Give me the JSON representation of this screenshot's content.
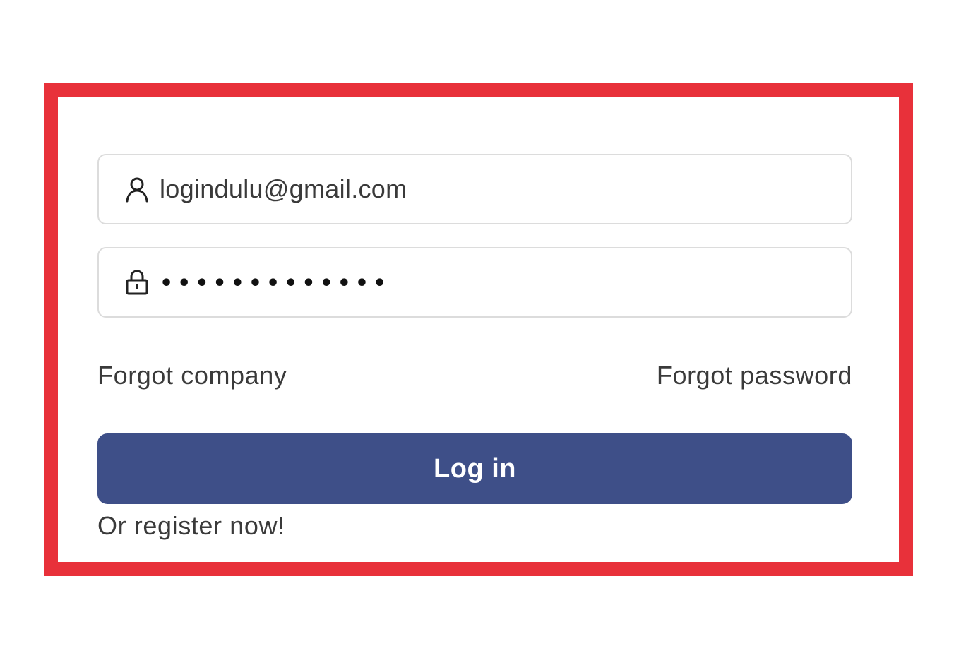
{
  "colors": {
    "highlight_border": "#e8313a",
    "button_background": "#3e4f88",
    "button_text": "#ffffff",
    "field_border": "#dcdcdc",
    "text": "#3a3a3a"
  },
  "login_form": {
    "username_field": {
      "icon": "user-icon",
      "value": "logindulu@gmail.com"
    },
    "password_field": {
      "icon": "lock-icon",
      "masked_value": "•••••••••••••"
    },
    "forgot_company_label": "Forgot company",
    "forgot_password_label": "Forgot password",
    "login_button_label": "Log in",
    "register_label": "Or register now!"
  }
}
